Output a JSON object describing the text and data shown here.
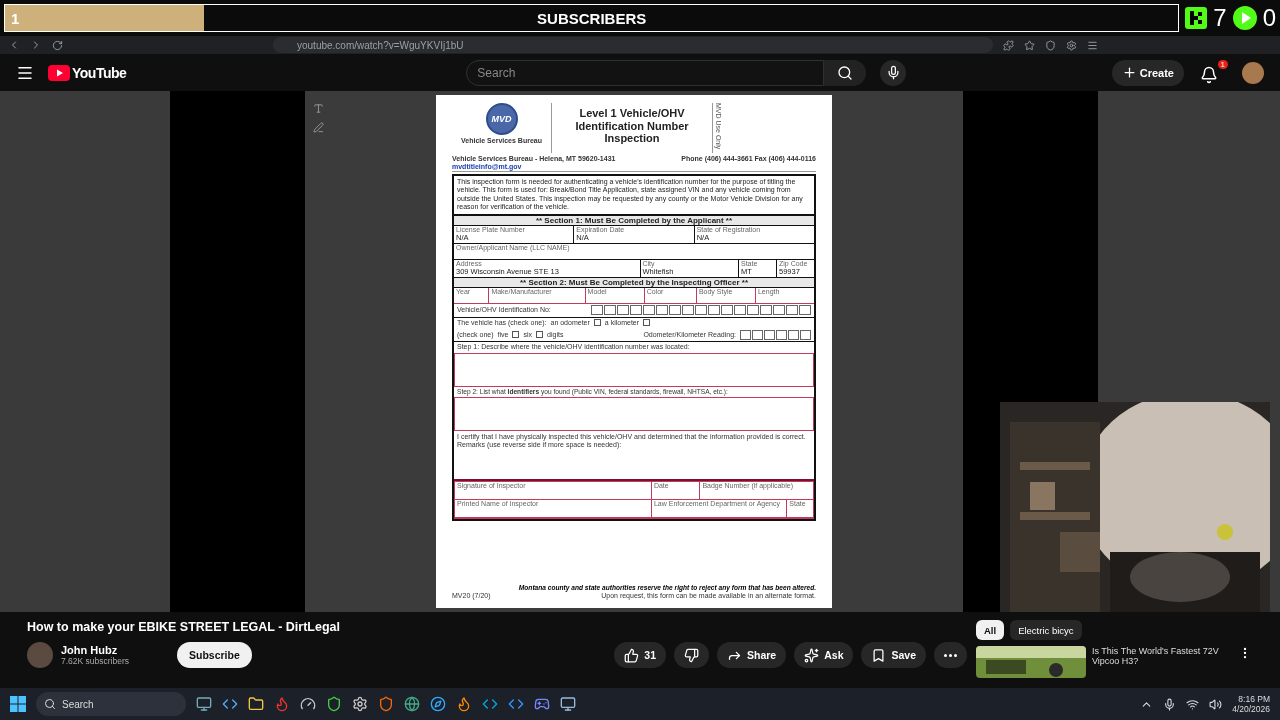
{
  "overlay": {
    "count": "1",
    "title": "SUBSCRIBERS",
    "level": 0.17,
    "follower_count": "7",
    "viewer_count": "0"
  },
  "browser": {
    "url": "youtube.com/watch?v=WguYKVIj1bU"
  },
  "header": {
    "logo": "YouTube",
    "search_placeholder": "Search",
    "create": "Create",
    "notifications": "1"
  },
  "form": {
    "logo": "MVD",
    "agency": "Vehicle Services Bureau",
    "title": "Level 1 Vehicle/OHV Identification Number Inspection",
    "side_note": "MVD Use Only",
    "address_line": "Vehicle Services Bureau - Helena, MT 59620-1431",
    "contact": "Phone (406) 444-3661   Fax (406) 444-0116",
    "email": "mvdtitleinfo@mt.gov",
    "intro": "This inspection form is needed for authenticating a vehicle's identification number for the purpose of titling the vehicle. This form is used for: Break/Bond Title Application, state assigned VIN and any vehicle coming from outside the United States. This inspection may be requested by any county or the Motor Vehicle Division for any reason for verification of the vehicle.",
    "section1": "** Section 1: Must Be Completed by the Applicant **",
    "section1_rows": [
      [
        {
          "label": "License Plate Number",
          "value": "N/A"
        },
        {
          "label": "Expiration Date",
          "value": "N/A"
        },
        {
          "label": "State of Registration",
          "value": "N/A"
        }
      ],
      [
        {
          "label": "Owner/Applicant Name (LLC NAME)"
        }
      ],
      [
        {
          "label": "Address",
          "value": "309 Wisconsin Avenue STE 13"
        },
        {
          "label": "City",
          "value": "Whitefish"
        },
        {
          "label": "State",
          "value": "MT"
        },
        {
          "label": "Zip Code",
          "value": "59937"
        }
      ]
    ],
    "section2": "** Section 2: Must Be Completed by the Inspecting Officer **",
    "section2_columns": [
      "Year",
      "Make/Manufacturer",
      "Model",
      "Color",
      "Body Style",
      "Length"
    ],
    "vin_label": "Vehicle/OHV Identification No:",
    "meter_label": "The vehicle has (check one):",
    "meter_options": [
      {
        "label": "an odometer",
        "checked": false
      },
      {
        "label": "a kilometer",
        "checked": false
      }
    ],
    "digits_label": "(check one)",
    "digit_options": [
      {
        "label": "five",
        "checked": false
      },
      {
        "label": "six",
        "checked": false
      }
    ],
    "digits_suffix": "digits",
    "reading_label": "Odometer/Kilometer Reading:",
    "step1": "Step 1: Describe where the vehicle/OHV identification number was located:",
    "step2": "Step 2: List what **Identifiers** you found (Public VIN, federal standards, firewall, NHTSA, etc.):",
    "certify": "I certify that I have physically inspected this vehicle/OHV and determined that the information provided is correct.",
    "remarks": "Remarks (use reverse side if more space is needed):",
    "signature_rows": [
      [
        "Signature of Inspector",
        "Date",
        "Badge Number (if applicable)"
      ],
      [
        "Printed Name of Inspector",
        "Law Enforcement Department or Agency",
        "State"
      ]
    ],
    "form_number": "MV20 (7/20)",
    "footer_bold": "Montana county and state authorities reserve the right to reject any form that has been altered.",
    "footer_note": "Upon request, this form can be made available in an alternate format."
  },
  "video": {
    "title": "How to make your EBIKE STREET LEGAL - DirtLegal",
    "channel": "John Hubz",
    "subscribers": "7.62K subscribers",
    "subscribe": "Subscribe",
    "likes": "31",
    "share": "Share",
    "ask": "Ask",
    "save": "Save"
  },
  "chips": [
    {
      "label": "All",
      "selected": true
    },
    {
      "label": "Electric bicyc",
      "selected": false
    }
  ],
  "recommendation": {
    "title_lines": [
      "Is This The World's Fastest 72V",
      "Vipcoo H3?"
    ]
  },
  "taskbar": {
    "search": "Search",
    "time": "8:16 PM",
    "date": "4/20/2026"
  }
}
